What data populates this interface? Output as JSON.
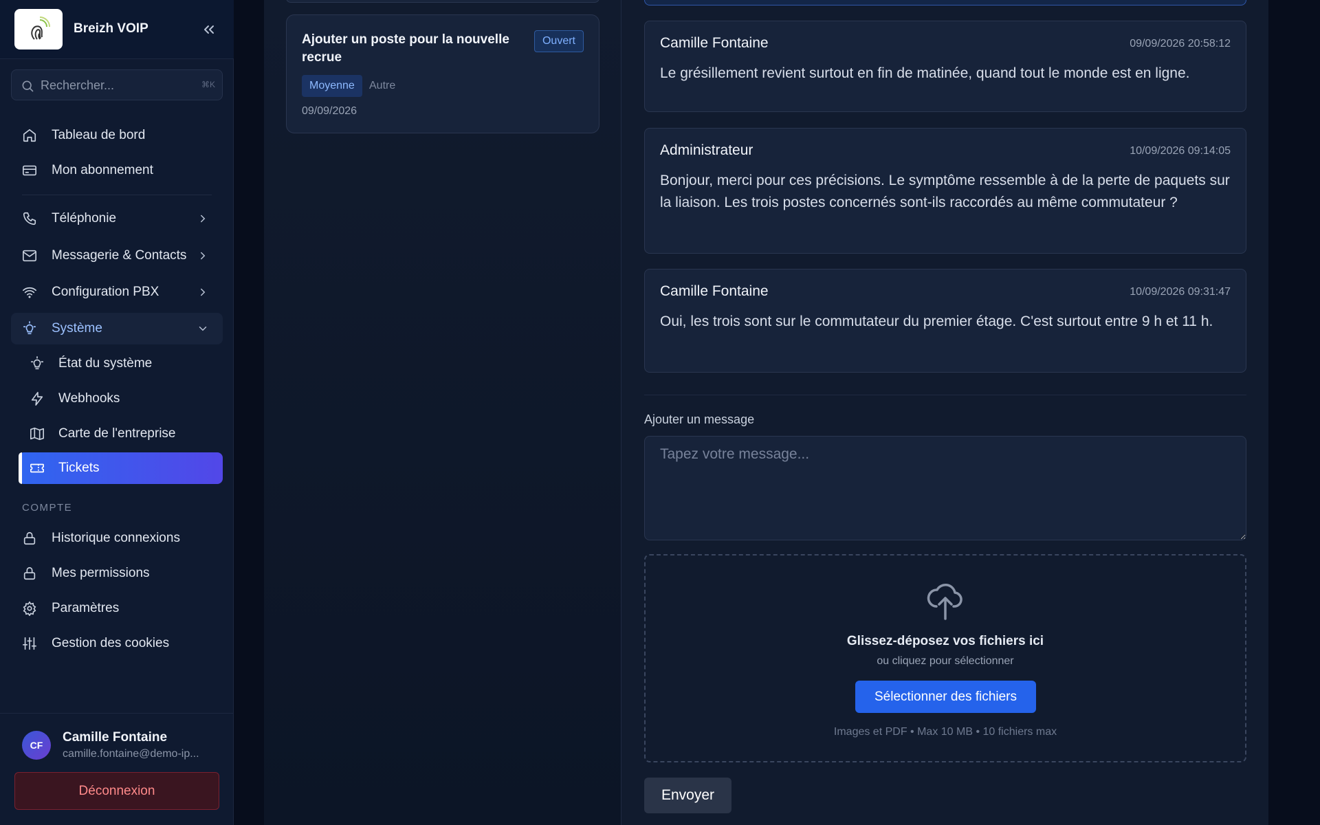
{
  "brand": {
    "name": "Breizh VOIP",
    "logo_icon": "fingerprint-wifi-logo"
  },
  "search": {
    "placeholder": "Rechercher...",
    "shortcut": "⌘K"
  },
  "nav": {
    "dashboard": "Tableau de bord",
    "subscription": "Mon abonnement",
    "telephony": "Téléphonie",
    "messaging": "Messagerie & Contacts",
    "pbx": "Configuration PBX",
    "system": "Système",
    "system_children": {
      "status": "État du système",
      "webhooks": "Webhooks",
      "map": "Carte de l'entreprise",
      "tickets": "Tickets"
    },
    "section_account": "COMPTE",
    "login_history": "Historique connexions",
    "permissions": "Mes permissions",
    "settings": "Paramètres",
    "cookies": "Gestion des cookies"
  },
  "user": {
    "initials": "CF",
    "name": "Camille Fontaine",
    "email": "camille.fontaine@demo-ip...",
    "logout_label": "Déconnexion"
  },
  "ticket_list": {
    "items": [
      {
        "title": "Ajouter un poste pour la nouvelle recrue",
        "status": "Ouvert",
        "priority": "Moyenne",
        "category": "Autre",
        "date": "09/09/2026"
      }
    ]
  },
  "messages": [
    {
      "author": "Camille Fontaine",
      "time": "09/09/2026 20:58:12",
      "body": "Le grésillement revient surtout en fin de matinée, quand tout le monde est en ligne."
    },
    {
      "author": "Administrateur",
      "time": "10/09/2026 09:14:05",
      "body": "Bonjour, merci pour ces précisions. Le symptôme ressemble à de la perte de paquets sur la liaison. Les trois postes concernés sont-ils raccordés au même commutateur ?"
    },
    {
      "author": "Camille Fontaine",
      "time": "10/09/2026 09:31:47",
      "body": "Oui, les trois sont sur le commutateur du premier étage. C'est surtout entre 9 h et 11 h."
    }
  ],
  "composer": {
    "label": "Ajouter un message",
    "placeholder": "Tapez votre message...",
    "dropzone_title": "Glissez-déposez vos fichiers ici",
    "dropzone_sub": "ou cliquez pour sélectionner",
    "select_files": "Sélectionner des fichiers",
    "hint": "Images et PDF • Max 10 MB • 10 fichiers max",
    "send": "Envoyer"
  },
  "colors": {
    "accent": "#2563eb",
    "active_gradient_start": "#2f66f0",
    "active_gradient_end": "#5247e8",
    "danger": "#ff8a8a"
  }
}
